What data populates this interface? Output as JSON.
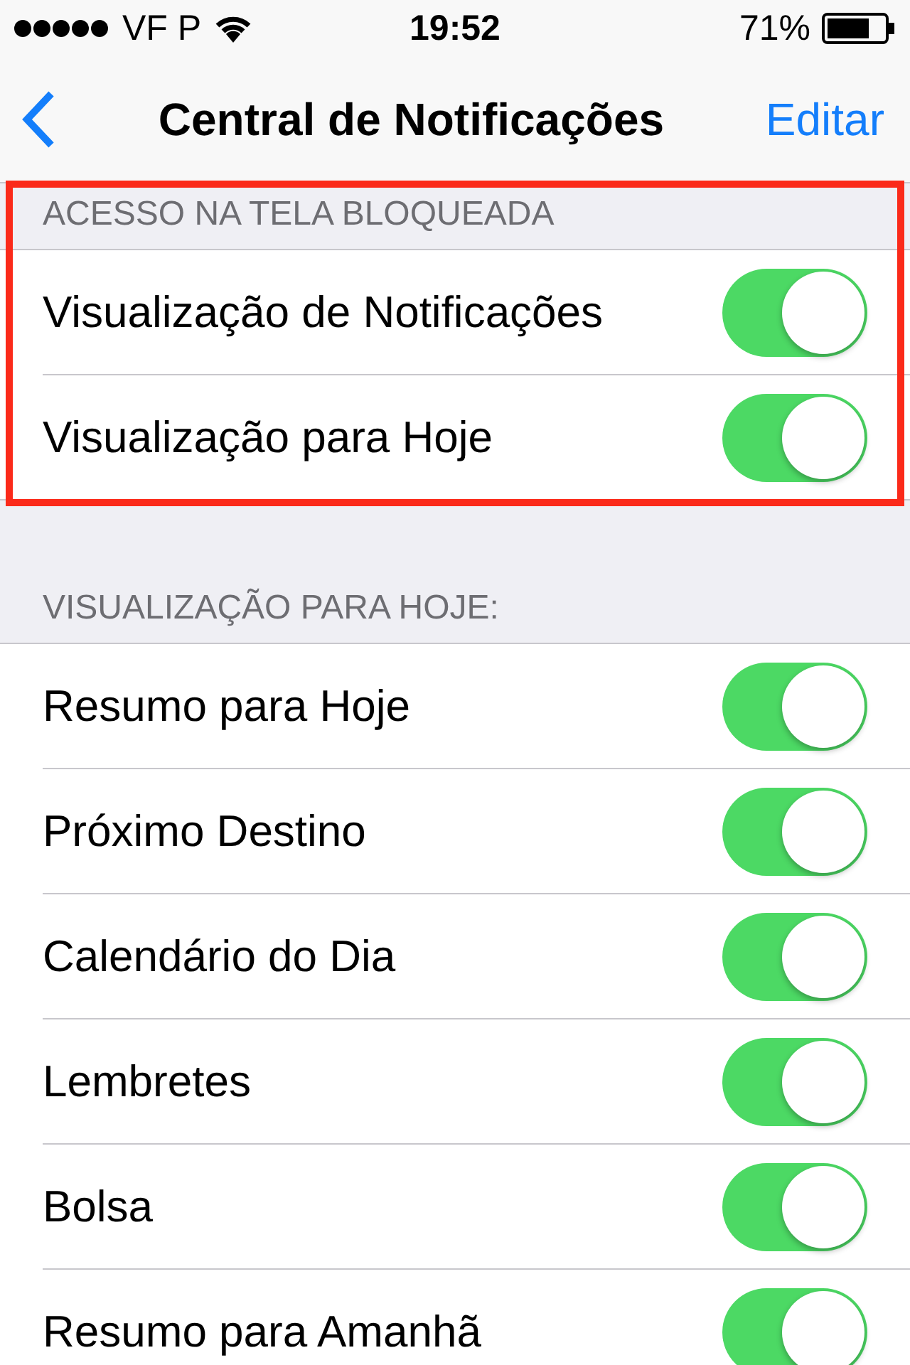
{
  "status_bar": {
    "carrier": "VF P",
    "time": "19:52",
    "battery": "71%"
  },
  "nav": {
    "title": "Central de Notificações",
    "action": "Editar"
  },
  "sections": [
    {
      "header": "ACESSO NA TELA BLOQUEADA",
      "highlighted": true,
      "rows": [
        {
          "label": "Visualização de Notificações",
          "on": true
        },
        {
          "label": "Visualização para Hoje",
          "on": true
        }
      ]
    },
    {
      "header": "VISUALIZAÇÃO PARA HOJE:",
      "rows": [
        {
          "label": "Resumo para Hoje",
          "on": true
        },
        {
          "label": "Próximo Destino",
          "on": true
        },
        {
          "label": "Calendário do Dia",
          "on": true
        },
        {
          "label": "Lembretes",
          "on": true
        },
        {
          "label": "Bolsa",
          "on": true
        },
        {
          "label": "Resumo para Amanhã",
          "on": true
        }
      ]
    }
  ]
}
